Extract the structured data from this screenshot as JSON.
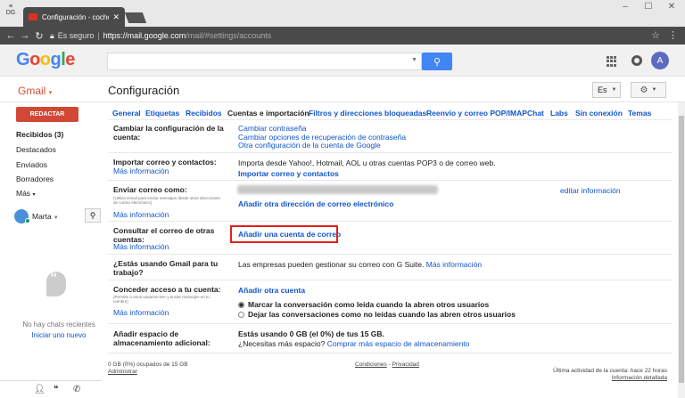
{
  "browser": {
    "tab_title": "Configuración - cochesje",
    "secure_label": "Es seguro",
    "url_host": "https://mail.google.com",
    "url_path": "/mail/#settings/accounts"
  },
  "header": {
    "logo": "Google",
    "avatar_letter": "A"
  },
  "app": {
    "gmail_label": "Gmail",
    "page_title": "Configuración",
    "language": "Es"
  },
  "sidebar": {
    "compose_label": "REDACTAR",
    "items": [
      {
        "label": "Recibidos (3)",
        "bold": true
      },
      {
        "label": "Destacados"
      },
      {
        "label": "Enviados"
      },
      {
        "label": "Borradores"
      },
      {
        "label": "Más"
      }
    ],
    "user_name": "Marta",
    "no_chats": "No hay chats recientes",
    "start_chat": "Iniciar uno nuevo"
  },
  "tabs": [
    {
      "label": "General"
    },
    {
      "label": "Etiquetas"
    },
    {
      "label": "Recibidos"
    },
    {
      "label": "Cuentas e importación",
      "active": true
    },
    {
      "label": "Filtros y direcciones bloqueadas"
    },
    {
      "label": "Reenvío y correo POP/IMAP"
    },
    {
      "label": "Chat"
    },
    {
      "label": "Labs"
    },
    {
      "label": "Sin conexión"
    },
    {
      "label": "Temas"
    }
  ],
  "rows": {
    "change_config": {
      "label": "Cambiar la configuración de la cuenta:",
      "links": [
        "Cambiar contraseña",
        "Cambiar opciones de recuperación de contraseña",
        "Otra configuración de la cuenta de Google"
      ]
    },
    "import": {
      "label": "Importar correo y contactos:",
      "info": "Más información",
      "text": "Importa desde Yahoo!, Hotmail, AOL u otras cuentas POP3 o de correo web.",
      "link": "Importar correo y contactos"
    },
    "send_as": {
      "label": "Enviar correo como:",
      "sub": "(Utiliza Gmail para enviar mensajes desde otras direcciones de correo electrónico)",
      "info": "Más información",
      "link": "Añadir otra dirección de correo electrónico",
      "edit": "editar información"
    },
    "check_mail": {
      "label": "Consultar el correo de otras cuentas:",
      "info": "Más información",
      "link": "Añadir una cuenta de correo"
    },
    "gsuite": {
      "label": "¿Estás usando Gmail para tu trabajo?",
      "text": "Las empresas pueden gestionar su correo con G Suite.",
      "link": "Más información"
    },
    "grant_access": {
      "label": "Conceder acceso a tu cuenta:",
      "sub": "(Permite a otros usuarios leer y enviar mensajes en tu nombre)",
      "info": "Más información",
      "link": "Añadir otra cuenta",
      "option1": "Marcar la conversación como leída cuando la abren otros usuarios",
      "option2": "Dejar las conversaciones como no leídas cuando las abren otros usuarios"
    },
    "storage": {
      "label": "Añadir espacio de almacenamiento adicional:",
      "text": "Estás usando 0 GB (el 0%) de tus 15 GB.",
      "question": "¿Necesitas más espacio?",
      "link": "Comprar más espacio de almacenamiento"
    }
  },
  "footer": {
    "usage": "0 GB (0%) ocupados de 15 GB",
    "manage": "Administrar",
    "terms": "Condiciones",
    "privacy": "Privacidad",
    "last_activity": "Última actividad de la cuenta: hace 22 horas",
    "details": "Información detallada"
  },
  "colors": {
    "compose": "#d14836",
    "link": "#1155cc",
    "highlight": "#e0201b"
  }
}
